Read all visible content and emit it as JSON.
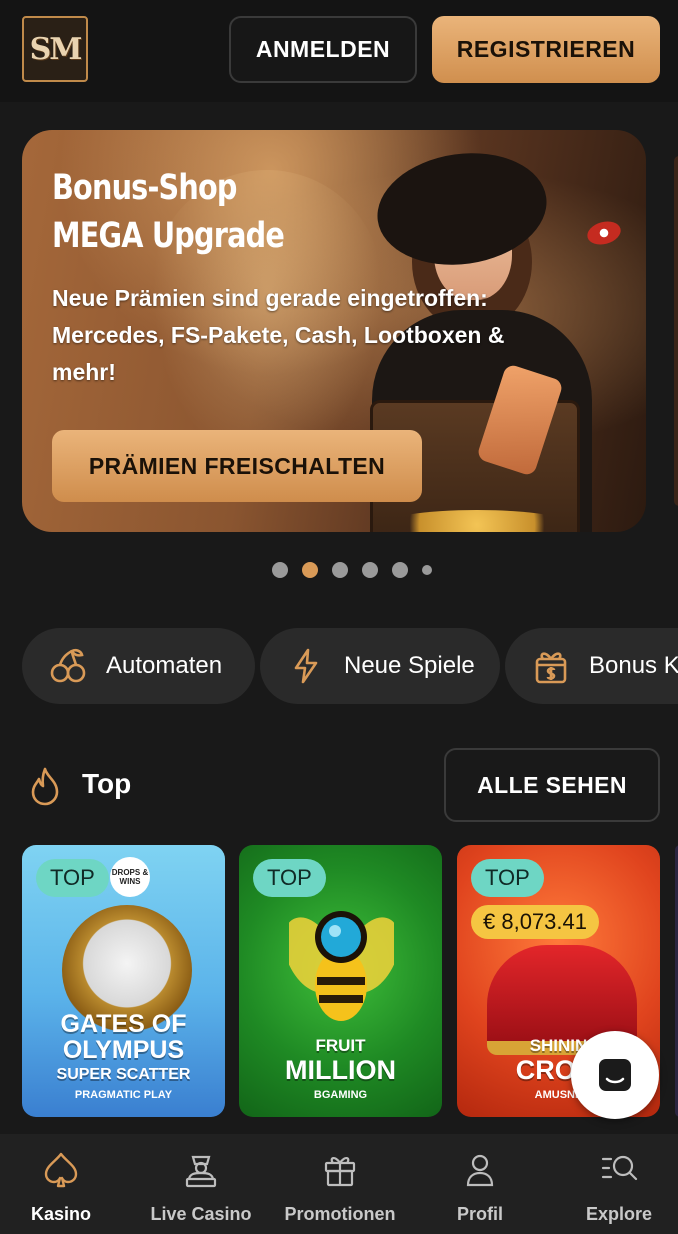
{
  "header": {
    "logo_text": "SM",
    "login_label": "ANMELDEN",
    "register_label": "REGISTRIEREN"
  },
  "banner": {
    "title_line1": "Bonus-Shop",
    "title_line2": "MEGA Upgrade",
    "subtitle": "Neue Prämien sind gerade eingetroffen: Mercedes, FS-Pakete, Cash, Lootboxen & mehr!",
    "cta_label": "PRÄMIEN FREISCHALTEN",
    "active_slide": 2,
    "slide_count": 6
  },
  "categories": [
    {
      "label": "Automaten",
      "icon": "cherries-icon"
    },
    {
      "label": "Neue Spiele",
      "icon": "lightning-icon"
    },
    {
      "label": "Bonus K",
      "icon": "gift-dollar-icon"
    }
  ],
  "top_section": {
    "icon": "flame-icon",
    "title": "Top",
    "see_all_label": "ALLE SEHEN"
  },
  "games": [
    {
      "tag": "TOP",
      "badge": "DROPS & WINS",
      "name_line1": "GATES OF",
      "name_line2": "OLYMPUS",
      "name_line3": "SUPER SCATTER",
      "provider": "PRAGMATIC PLAY"
    },
    {
      "tag": "TOP",
      "name_line1": "FRUIT",
      "name_line2": "MILLION",
      "provider": "BGAMING"
    },
    {
      "tag": "TOP",
      "jackpot": "€ 8,073.41",
      "name_line1": "SHININ",
      "name_line2": "CROW",
      "provider": "AMUSNE"
    }
  ],
  "nav": [
    {
      "label": "Kasino",
      "icon": "spade-icon",
      "active": true
    },
    {
      "label": "Live Casino",
      "icon": "dealer-icon",
      "active": false
    },
    {
      "label": "Promotionen",
      "icon": "gift-icon",
      "active": false
    },
    {
      "label": "Profil",
      "icon": "user-icon",
      "active": false
    },
    {
      "label": "Explore",
      "icon": "search-list-icon",
      "active": false
    }
  ],
  "colors": {
    "accent": "#d99a57",
    "tag": "#6ed6c4",
    "jackpot": "#f5c542",
    "background": "#191919"
  }
}
